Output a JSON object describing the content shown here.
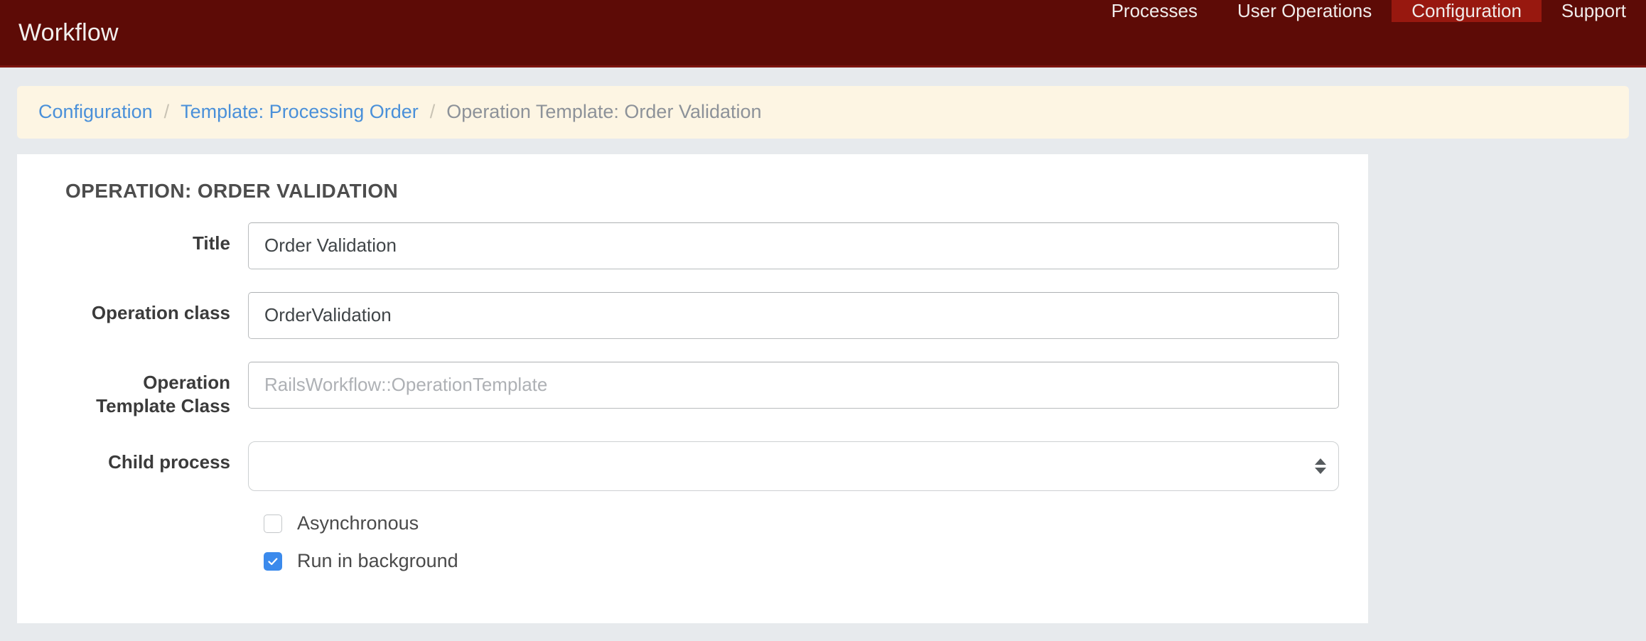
{
  "theme": {
    "navbar_bg": "#5d0b06",
    "navbar_active_bg": "#98180f",
    "page_bg": "#e7eaed",
    "breadcrumb_bg": "#fdf5e3",
    "link_color": "#4a90d9",
    "panel_bg": "#ffffff",
    "checkbox_checked": "#3b8aec"
  },
  "navbar": {
    "brand": "Workflow",
    "items": [
      {
        "label": "Processes",
        "active": false
      },
      {
        "label": "User Operations",
        "active": false
      },
      {
        "label": "Configuration",
        "active": true
      },
      {
        "label": "Support",
        "active": false
      }
    ]
  },
  "breadcrumb": {
    "separator": "/",
    "items": [
      {
        "label": "Configuration",
        "is_link": true
      },
      {
        "label": "Template: Processing Order",
        "is_link": true
      },
      {
        "label": "Operation Template: Order Validation",
        "is_link": false
      }
    ]
  },
  "panel": {
    "title": "OPERATION: ORDER VALIDATION",
    "fields": [
      {
        "label": "Title",
        "type": "text",
        "value": "Order Validation",
        "placeholder": ""
      },
      {
        "label": "Operation class",
        "type": "text",
        "value": "OrderValidation",
        "placeholder": ""
      },
      {
        "label_line1": "Operation",
        "label_line2": "Template Class",
        "type": "text",
        "value": "",
        "placeholder": "RailsWorkflow::OperationTemplate"
      },
      {
        "label": "Child process",
        "type": "select",
        "selected": "",
        "options": [
          ""
        ]
      }
    ],
    "checkboxes": [
      {
        "label": "Asynchronous",
        "checked": false
      },
      {
        "label": "Run in background",
        "checked": true
      }
    ]
  }
}
